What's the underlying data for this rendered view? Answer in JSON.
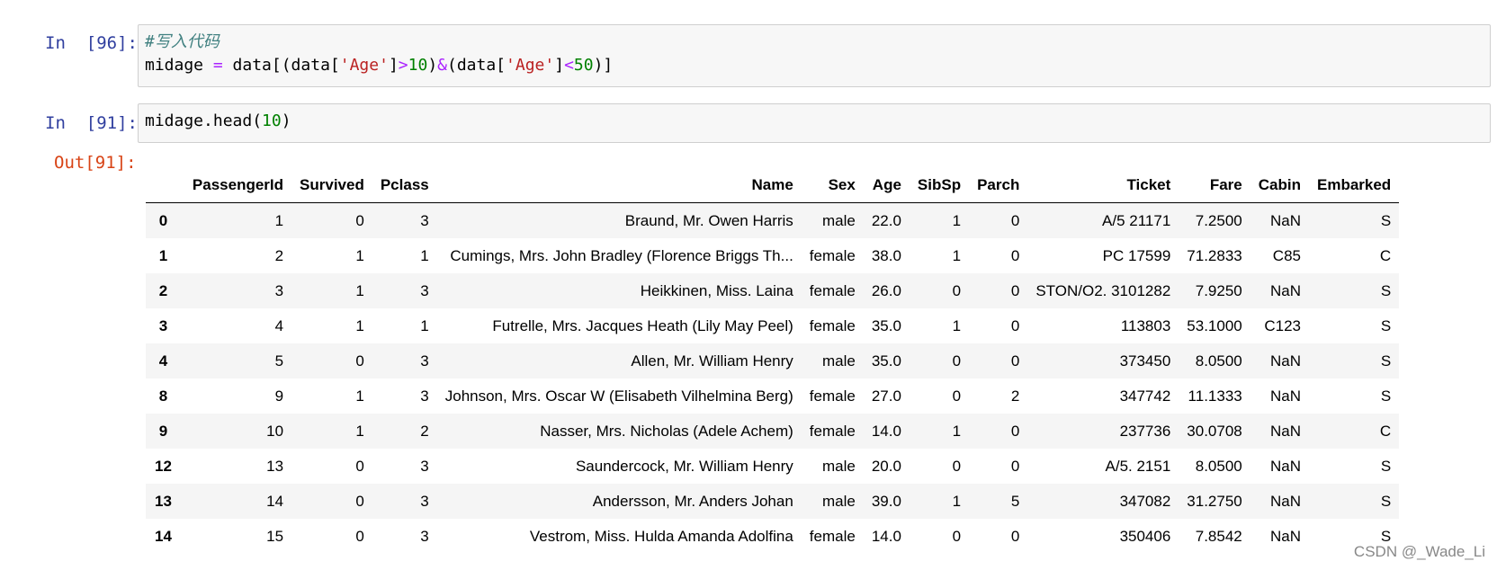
{
  "cells": [
    {
      "prompt": "In  [96]:",
      "code_line1": "#写入代码",
      "code_line2": {
        "t1": "midage ",
        "op1": "=",
        "t2": " data[(data[",
        "s1": "'Age'",
        "t3": "]",
        "op2": ">",
        "n1": "10",
        "t4": ")",
        "op3": "&",
        "t5": "(data[",
        "s2": "'Age'",
        "t6": "]",
        "op4": "<",
        "n2": "50",
        "t7": ")]"
      }
    },
    {
      "prompt": "In  [91]:",
      "code": {
        "t1": "midage.head(",
        "n1": "10",
        "t2": ")"
      },
      "out_prompt": "Out[91]:"
    }
  ],
  "table": {
    "columns": [
      "",
      "PassengerId",
      "Survived",
      "Pclass",
      "Name",
      "Sex",
      "Age",
      "SibSp",
      "Parch",
      "Ticket",
      "Fare",
      "Cabin",
      "Embarked"
    ],
    "rows": [
      [
        "0",
        "1",
        "0",
        "3",
        "Braund, Mr. Owen Harris",
        "male",
        "22.0",
        "1",
        "0",
        "A/5 21171",
        "7.2500",
        "NaN",
        "S"
      ],
      [
        "1",
        "2",
        "1",
        "1",
        "Cumings, Mrs. John Bradley (Florence Briggs Th...",
        "female",
        "38.0",
        "1",
        "0",
        "PC 17599",
        "71.2833",
        "C85",
        "C"
      ],
      [
        "2",
        "3",
        "1",
        "3",
        "Heikkinen, Miss. Laina",
        "female",
        "26.0",
        "0",
        "0",
        "STON/O2. 3101282",
        "7.9250",
        "NaN",
        "S"
      ],
      [
        "3",
        "4",
        "1",
        "1",
        "Futrelle, Mrs. Jacques Heath (Lily May Peel)",
        "female",
        "35.0",
        "1",
        "0",
        "113803",
        "53.1000",
        "C123",
        "S"
      ],
      [
        "4",
        "5",
        "0",
        "3",
        "Allen, Mr. William Henry",
        "male",
        "35.0",
        "0",
        "0",
        "373450",
        "8.0500",
        "NaN",
        "S"
      ],
      [
        "8",
        "9",
        "1",
        "3",
        "Johnson, Mrs. Oscar W (Elisabeth Vilhelmina Berg)",
        "female",
        "27.0",
        "0",
        "2",
        "347742",
        "11.1333",
        "NaN",
        "S"
      ],
      [
        "9",
        "10",
        "1",
        "2",
        "Nasser, Mrs. Nicholas (Adele Achem)",
        "female",
        "14.0",
        "1",
        "0",
        "237736",
        "30.0708",
        "NaN",
        "C"
      ],
      [
        "12",
        "13",
        "0",
        "3",
        "Saundercock, Mr. William Henry",
        "male",
        "20.0",
        "0",
        "0",
        "A/5. 2151",
        "8.0500",
        "NaN",
        "S"
      ],
      [
        "13",
        "14",
        "0",
        "3",
        "Andersson, Mr. Anders Johan",
        "male",
        "39.0",
        "1",
        "5",
        "347082",
        "31.2750",
        "NaN",
        "S"
      ],
      [
        "14",
        "15",
        "0",
        "3",
        "Vestrom, Miss. Hulda Amanda Adolfina",
        "female",
        "14.0",
        "0",
        "0",
        "350406",
        "7.8542",
        "NaN",
        "S"
      ]
    ]
  },
  "watermark": "CSDN @_Wade_Li",
  "colors": {
    "in_prompt": "#303f9f",
    "out_prompt": "#d84315",
    "cell_bg": "#f7f7f7",
    "comment": "#408080",
    "string": "#ba2121",
    "number": "#008000",
    "operator": "#aa22ff"
  }
}
